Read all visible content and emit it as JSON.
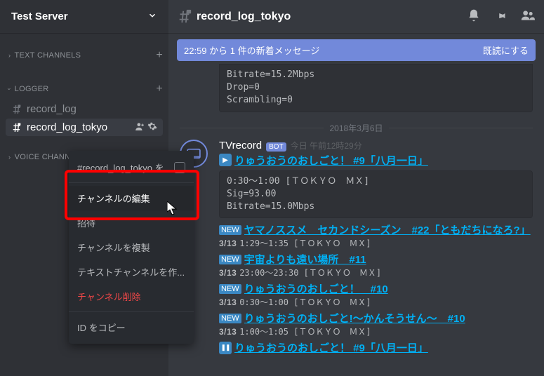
{
  "server": {
    "name": "Test Server"
  },
  "categories": {
    "text": {
      "label": "TEXT CHANNELS"
    },
    "logger": {
      "label": "LOGGER",
      "channels": [
        {
          "name": "record_log"
        },
        {
          "name": "record_log_tokyo"
        }
      ]
    },
    "voice": {
      "label": "VOICE CHANNEL"
    }
  },
  "contextMenu": {
    "mute": "#record_log_tokyo を",
    "edit": "チャンネルの編集",
    "invite": "招待",
    "duplicate": "チャンネルを複製",
    "createText": "テキストチャンネルを作...",
    "delete": "チャンネル削除",
    "copyId": "ID をコピー"
  },
  "header": {
    "channel": "record_log_tokyo"
  },
  "notice": {
    "text": "22:59 から 1 件の新着メッセージ",
    "action": "既読にする"
  },
  "prevBlock": "Bitrate=15.2Mbps\nDrop=0\nScrambling=0",
  "divider": "2018年3月6日",
  "message": {
    "author": "TVrecord",
    "bot": "BOT",
    "time": "今日 午前12時29分",
    "entries": [
      {
        "badge": "play",
        "title": "りゅうおうのおしごと！ #9「八月一日」"
      }
    ],
    "block": "0:30～1:00 [ＴＯＫＹＯ　ＭＸ]\nSig=93.00\nBitrate=15.0Mbps",
    "list": [
      {
        "badge": "new",
        "title": "ヤマノススメ　セカンドシーズン　#22「ともだちになろ?」",
        "sub": "3/13 1:29～1:35 [ＴＯＫＹＯ　ＭＸ]"
      },
      {
        "badge": "new",
        "title": "宇宙よりも遠い場所　#11",
        "sub": "3/13 23:00～23:30 [ＴＯＫＹＯ　ＭＸ]"
      },
      {
        "badge": "new",
        "title": "りゅうおうのおしごと！　#10",
        "sub": "3/13 0:30～1:00 [ＴＯＫＹＯ　ＭＸ]"
      },
      {
        "badge": "new",
        "title": "りゅうおうのおしごと!～かんそうせん～　#10",
        "sub": "3/13 1:00～1:05 [ＴＯＫＹＯ　ＭＸ]"
      },
      {
        "badge": "pause",
        "title": "りゅうおうのおしごと！ #9「八月一日」",
        "sub": ""
      }
    ]
  }
}
